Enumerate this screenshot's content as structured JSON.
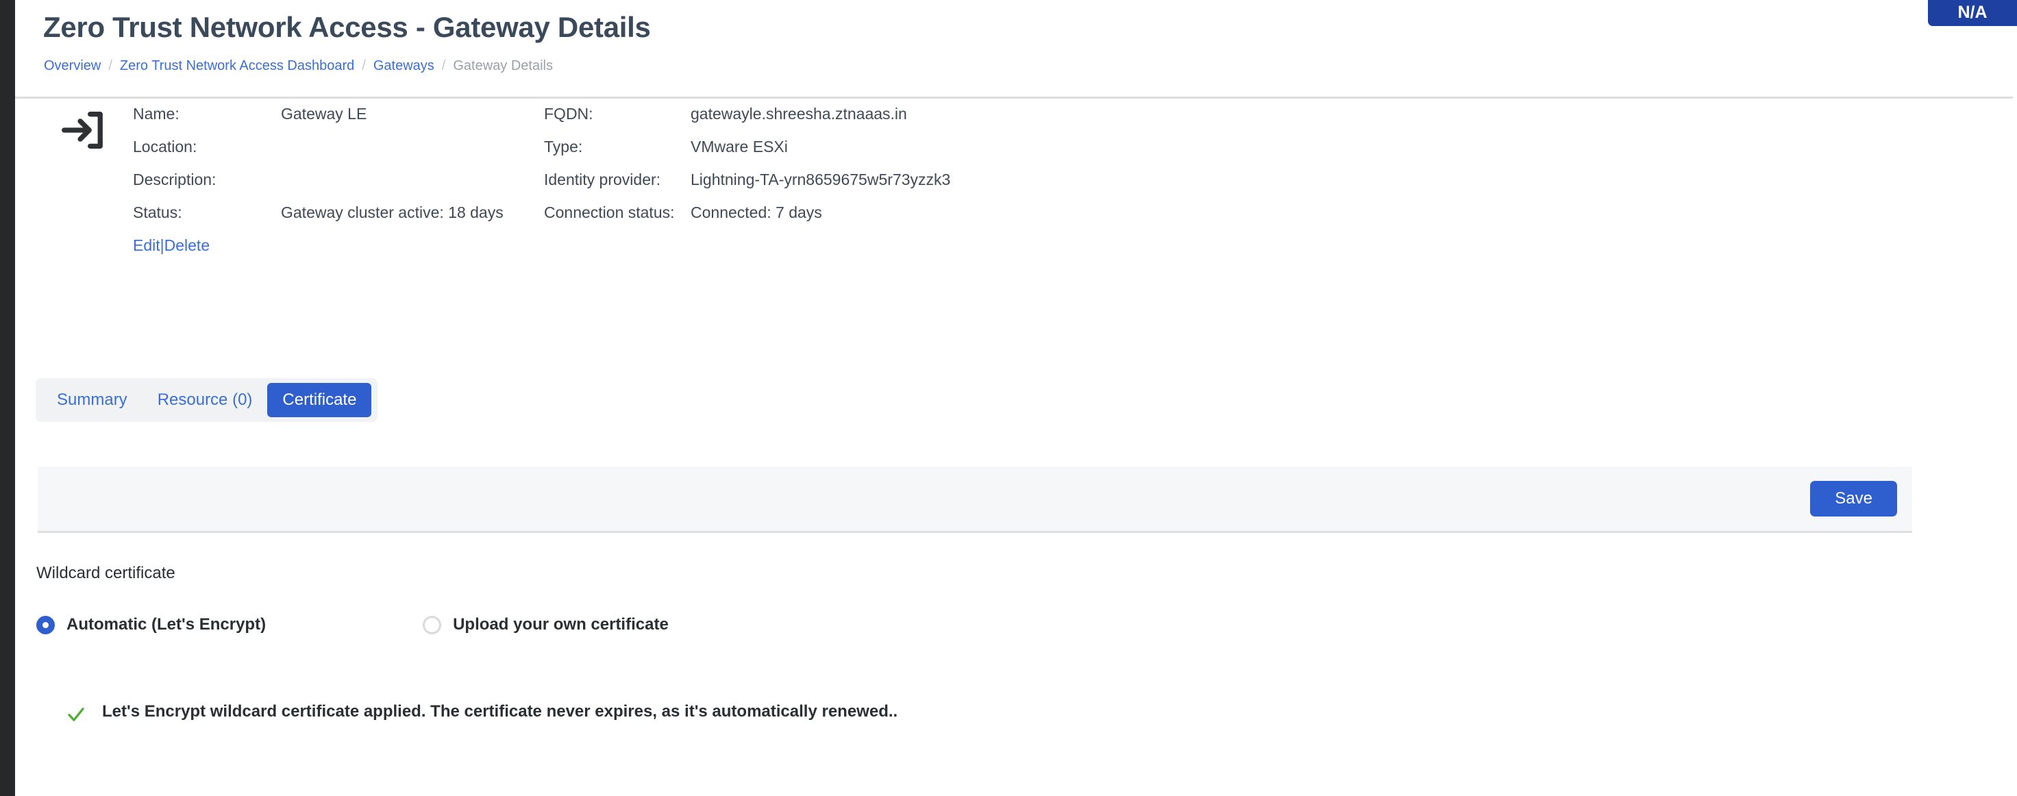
{
  "header": {
    "title": "Zero Trust Network Access - Gateway Details",
    "breadcrumb": [
      {
        "label": "Overview",
        "link": true
      },
      {
        "label": "Zero Trust Network Access Dashboard",
        "link": true
      },
      {
        "label": "Gateways",
        "link": true
      },
      {
        "label": "Gateway Details",
        "link": false
      }
    ],
    "separator": "/",
    "badge": "N/A",
    "badge_color": "#1e40a0"
  },
  "gateway": {
    "icon": "sign-in-icon",
    "left_labels": [
      "Name:",
      "Location:",
      "Description:",
      "Status:"
    ],
    "left_values": [
      "Gateway LE",
      "",
      "",
      "Gateway cluster active: 18 days"
    ],
    "right_labels": [
      "FQDN:",
      "Type:",
      "Identity provider:",
      "Connection status:"
    ],
    "right_values": [
      "gatewayle.shreesha.ztnaaas.in",
      "VMware ESXi",
      "Lightning-TA-yrn8659675w5r73yzzk3",
      "Connected: 7 days"
    ],
    "actions": {
      "edit": "Edit",
      "separator": "|",
      "delete": "Delete"
    }
  },
  "tabs": [
    {
      "label": "Summary",
      "active": false
    },
    {
      "label": "Resource (0)",
      "active": false
    },
    {
      "label": "Certificate",
      "active": true
    }
  ],
  "toolbar": {
    "save_label": "Save"
  },
  "certificate": {
    "section_title": "Wildcard certificate",
    "options": [
      {
        "label": "Automatic (Let's Encrypt)",
        "selected": true
      },
      {
        "label": "Upload your own certificate",
        "selected": false
      }
    ],
    "status_message": "Let's Encrypt wildcard certificate applied. The certificate never expires, as it's automatically renewed..",
    "status_icon": "check-icon",
    "status_color": "#4caf32"
  },
  "theme": {
    "accent": "#2f5fcf",
    "link": "#3b6fd4",
    "title": "#3b4a5a",
    "rail": "#26282a"
  }
}
